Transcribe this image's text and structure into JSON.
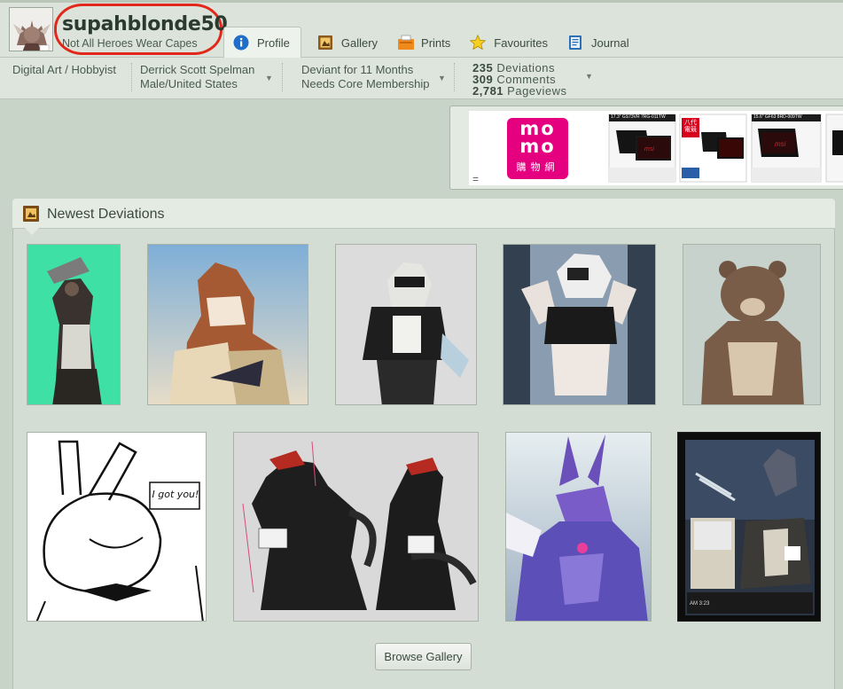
{
  "profile": {
    "username": "supahblonde50",
    "tagline": "Not All Heroes Wear Capes"
  },
  "tabs": [
    {
      "label": "Profile",
      "icon": "info-icon",
      "active": true
    },
    {
      "label": "Gallery",
      "icon": "gallery-icon"
    },
    {
      "label": "Prints",
      "icon": "prints-icon"
    },
    {
      "label": "Favourites",
      "icon": "star-icon"
    },
    {
      "label": "Journal",
      "icon": "journal-icon"
    }
  ],
  "info": {
    "category": "Digital Art / Hobbyist",
    "realname": "Derrick Scott Spelman",
    "location": "Male/United States",
    "deviant_for": "Deviant for 11 Months",
    "membership": "Needs Core Membership",
    "stats": [
      {
        "value": "235",
        "label": "Deviations"
      },
      {
        "value": "309",
        "label": "Comments"
      },
      {
        "value": "2,781",
        "label": "Pageviews"
      }
    ]
  },
  "ad": {
    "brand_line1": "mo",
    "brand_line2": "mo",
    "brand_sub": "購物網",
    "eq": "=",
    "products": [
      {
        "model": "17.3\" GS73VR 7RG-011TW"
      },
      {
        "model": "八代 電競"
      },
      {
        "model": "15.6\" GF63 8RD-009TW"
      }
    ]
  },
  "panel": {
    "title": "Newest Deviations",
    "browse_label": "Browse Gallery"
  },
  "thumb_text": {
    "speech": "I got you!",
    "time": "AM 3:23"
  },
  "colors": {
    "accent_red": "#e1281a",
    "profile_tab_icon": "#1f6fc9",
    "panel_bg": "#d4ddd3",
    "momo_pink": "#e5007f"
  }
}
